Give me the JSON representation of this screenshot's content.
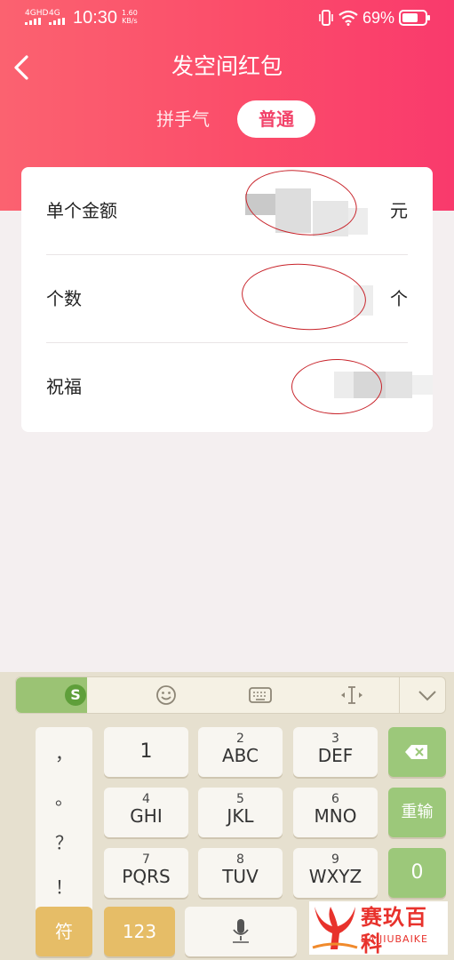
{
  "status_bar": {
    "network1": "4GHD",
    "network2": "4G",
    "time": "10:30",
    "speed_value": "1.60",
    "speed_unit": "KB/s",
    "battery": "69%"
  },
  "header": {
    "title": "发空间红包",
    "tabs": [
      {
        "label": "拼手气",
        "selected": false
      },
      {
        "label": "普通",
        "selected": true
      }
    ]
  },
  "form": {
    "rows": [
      {
        "label": "单个金额",
        "unit": "元"
      },
      {
        "label": "个数",
        "unit": "个"
      },
      {
        "label": "祝福",
        "unit": ""
      }
    ]
  },
  "keyboard": {
    "logo": "S",
    "punctuation": [
      "，",
      "。",
      "？",
      "！"
    ],
    "keys": [
      {
        "num": "",
        "letters": "1"
      },
      {
        "num": "2",
        "letters": "ABC"
      },
      {
        "num": "3",
        "letters": "DEF"
      },
      {
        "num": "4",
        "letters": "GHI"
      },
      {
        "num": "5",
        "letters": "JKL"
      },
      {
        "num": "6",
        "letters": "MNO"
      },
      {
        "num": "7",
        "letters": "PQRS"
      },
      {
        "num": "8",
        "letters": "TUV"
      },
      {
        "num": "9",
        "letters": "WXYZ"
      }
    ],
    "reenter": "重输",
    "zero": "0",
    "symbol": "符",
    "numeric": "123"
  },
  "watermark": {
    "main": "赛玖百科",
    "sub": "SAIJIUBAIKE"
  },
  "colors": {
    "header_start": "#fb6270",
    "header_end": "#f93a6c",
    "accent": "#f2436a",
    "annotation_red": "#c8242b"
  }
}
